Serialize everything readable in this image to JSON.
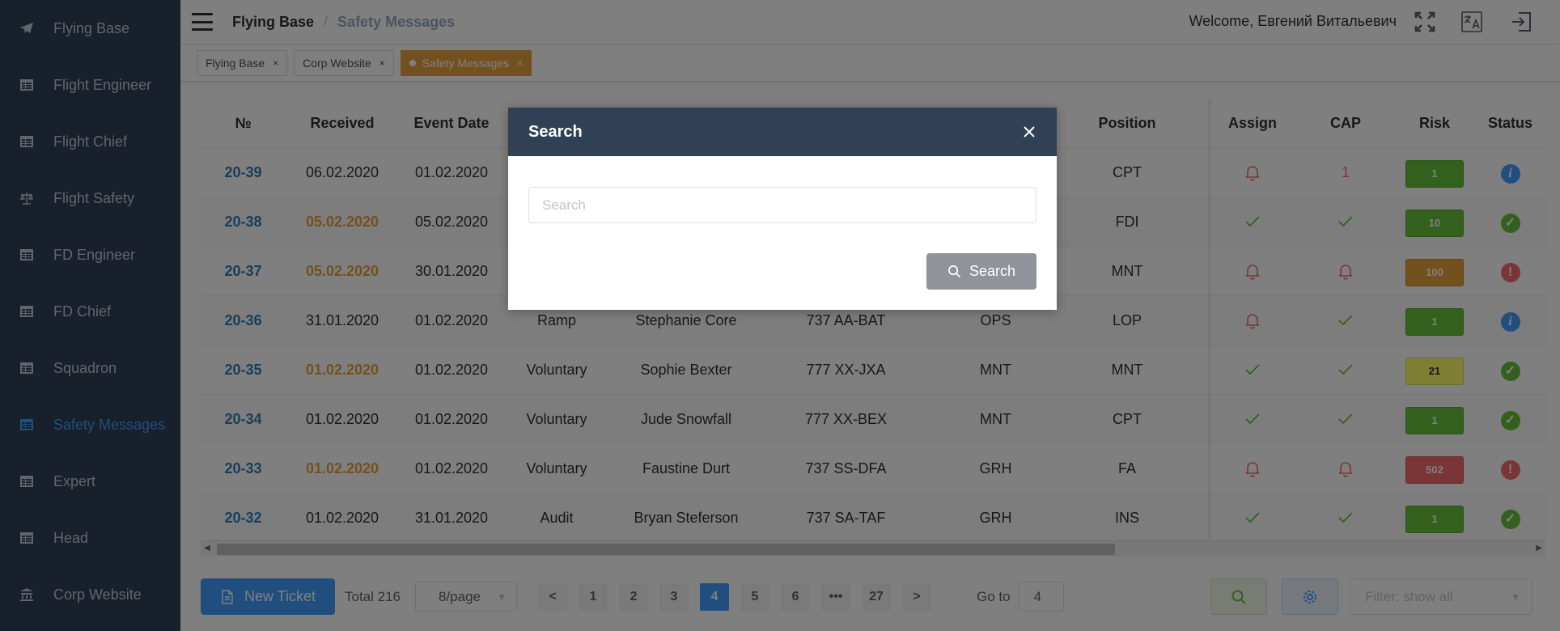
{
  "sidebar": {
    "items": [
      {
        "label": "Flying Base",
        "icon": "plane-icon"
      },
      {
        "label": "Flight Engineer",
        "icon": "table-icon"
      },
      {
        "label": "Flight Chief",
        "icon": "table-icon"
      },
      {
        "label": "Flight Safety",
        "icon": "scales-icon"
      },
      {
        "label": "FD Engineer",
        "icon": "table-icon"
      },
      {
        "label": "FD Chief",
        "icon": "table-icon"
      },
      {
        "label": "Squadron",
        "icon": "table-icon"
      },
      {
        "label": "Safety Messages",
        "icon": "table-icon",
        "active": true
      },
      {
        "label": "Expert",
        "icon": "table-icon"
      },
      {
        "label": "Head",
        "icon": "table-icon"
      },
      {
        "label": "Corp Website",
        "icon": "bank-icon"
      }
    ]
  },
  "header": {
    "breadcrumb_root": "Flying Base",
    "breadcrumb_sep": "/",
    "breadcrumb_current": "Safety Messages",
    "welcome": "Welcome, Евгений Витальевич"
  },
  "tags": [
    {
      "label": "Flying Base",
      "close": "×"
    },
    {
      "label": "Corp Website",
      "close": "×"
    },
    {
      "label": "Safety Messages",
      "close": "×",
      "active": true
    }
  ],
  "table": {
    "headers": {
      "no": "№",
      "received": "Received",
      "event_date": "Event Date",
      "position": "Position",
      "assign": "Assign",
      "cap": "CAP",
      "risk": "Risk",
      "status": "Status"
    },
    "rows": [
      {
        "no": "20-39",
        "received": "06.02.2020",
        "received_highlight": false,
        "event_date": "01.02.2020",
        "type": "",
        "name": "",
        "aircraft": "",
        "dept": "",
        "position": "CPT",
        "assign": "bell",
        "cap": "1",
        "risk": "1",
        "risk_color": "#67c23a",
        "status": "info"
      },
      {
        "no": "20-38",
        "received": "05.02.2020",
        "received_highlight": true,
        "event_date": "05.02.2020",
        "type": "",
        "name": "",
        "aircraft": "",
        "dept": "",
        "position": "FDI",
        "assign": "check",
        "cap": "check",
        "risk": "10",
        "risk_color": "#67c23a",
        "status": "ok"
      },
      {
        "no": "20-37",
        "received": "05.02.2020",
        "received_highlight": true,
        "event_date": "30.01.2020",
        "type": "",
        "name": "",
        "aircraft": "",
        "dept": "",
        "position": "MNT",
        "assign": "bell",
        "cap": "bell",
        "risk": "100",
        "risk_color": "#e6a23c",
        "status": "alert"
      },
      {
        "no": "20-36",
        "received": "31.01.2020",
        "received_highlight": false,
        "event_date": "01.02.2020",
        "type": "Ramp",
        "name": "Stephanie Core",
        "aircraft": "737 AA-BAT",
        "dept": "OPS",
        "position": "LOP",
        "assign": "bell",
        "cap": "check",
        "risk": "1",
        "risk_color": "#67c23a",
        "status": "info"
      },
      {
        "no": "20-35",
        "received": "01.02.2020",
        "received_highlight": true,
        "event_date": "01.02.2020",
        "type": "Voluntary",
        "name": "Sophie Bexter",
        "aircraft": "777 XX-JXA",
        "dept": "MNT",
        "position": "MNT",
        "assign": "check",
        "cap": "check",
        "risk": "21",
        "risk_color": "#ffff66",
        "status": "ok"
      },
      {
        "no": "20-34",
        "received": "01.02.2020",
        "received_highlight": false,
        "event_date": "01.02.2020",
        "type": "Voluntary",
        "name": "Jude Snowfall",
        "aircraft": "777 XX-BEX",
        "dept": "MNT",
        "position": "CPT",
        "assign": "check",
        "cap": "check",
        "risk": "1",
        "risk_color": "#67c23a",
        "status": "ok"
      },
      {
        "no": "20-33",
        "received": "01.02.2020",
        "received_highlight": true,
        "event_date": "01.02.2020",
        "type": "Voluntary",
        "name": "Faustine Durt",
        "aircraft": "737 SS-DFA",
        "dept": "GRH",
        "position": "FA",
        "assign": "bell",
        "cap": "bell",
        "risk": "502",
        "risk_color": "#f56c6c",
        "status": "alert"
      },
      {
        "no": "20-32",
        "received": "01.02.2020",
        "received_highlight": false,
        "event_date": "31.01.2020",
        "type": "Audit",
        "name": "Bryan Steferson",
        "aircraft": "737 SA-TAF",
        "dept": "GRH",
        "position": "INS",
        "assign": "check",
        "cap": "check",
        "risk": "1",
        "risk_color": "#67c23a",
        "status": "ok"
      }
    ]
  },
  "footer": {
    "new_ticket": "New Ticket",
    "total": "Total 216",
    "page_size": "8/page",
    "pages": [
      "1",
      "2",
      "3",
      "4",
      "5",
      "6",
      "•••",
      "27"
    ],
    "current_page": "4",
    "prev": "<",
    "next": ">",
    "goto_label": "Go to",
    "goto_value": "4",
    "filter_placeholder": "Filter: show all"
  },
  "dialog": {
    "title": "Search",
    "input_placeholder": "Search",
    "button_label": "Search"
  },
  "colors": {
    "sidebar_bg": "#304156",
    "accent": "#409eff",
    "orange": "#e6a23c",
    "green": "#67c23a",
    "red": "#f56c6c",
    "dialog_header": "#304156"
  }
}
